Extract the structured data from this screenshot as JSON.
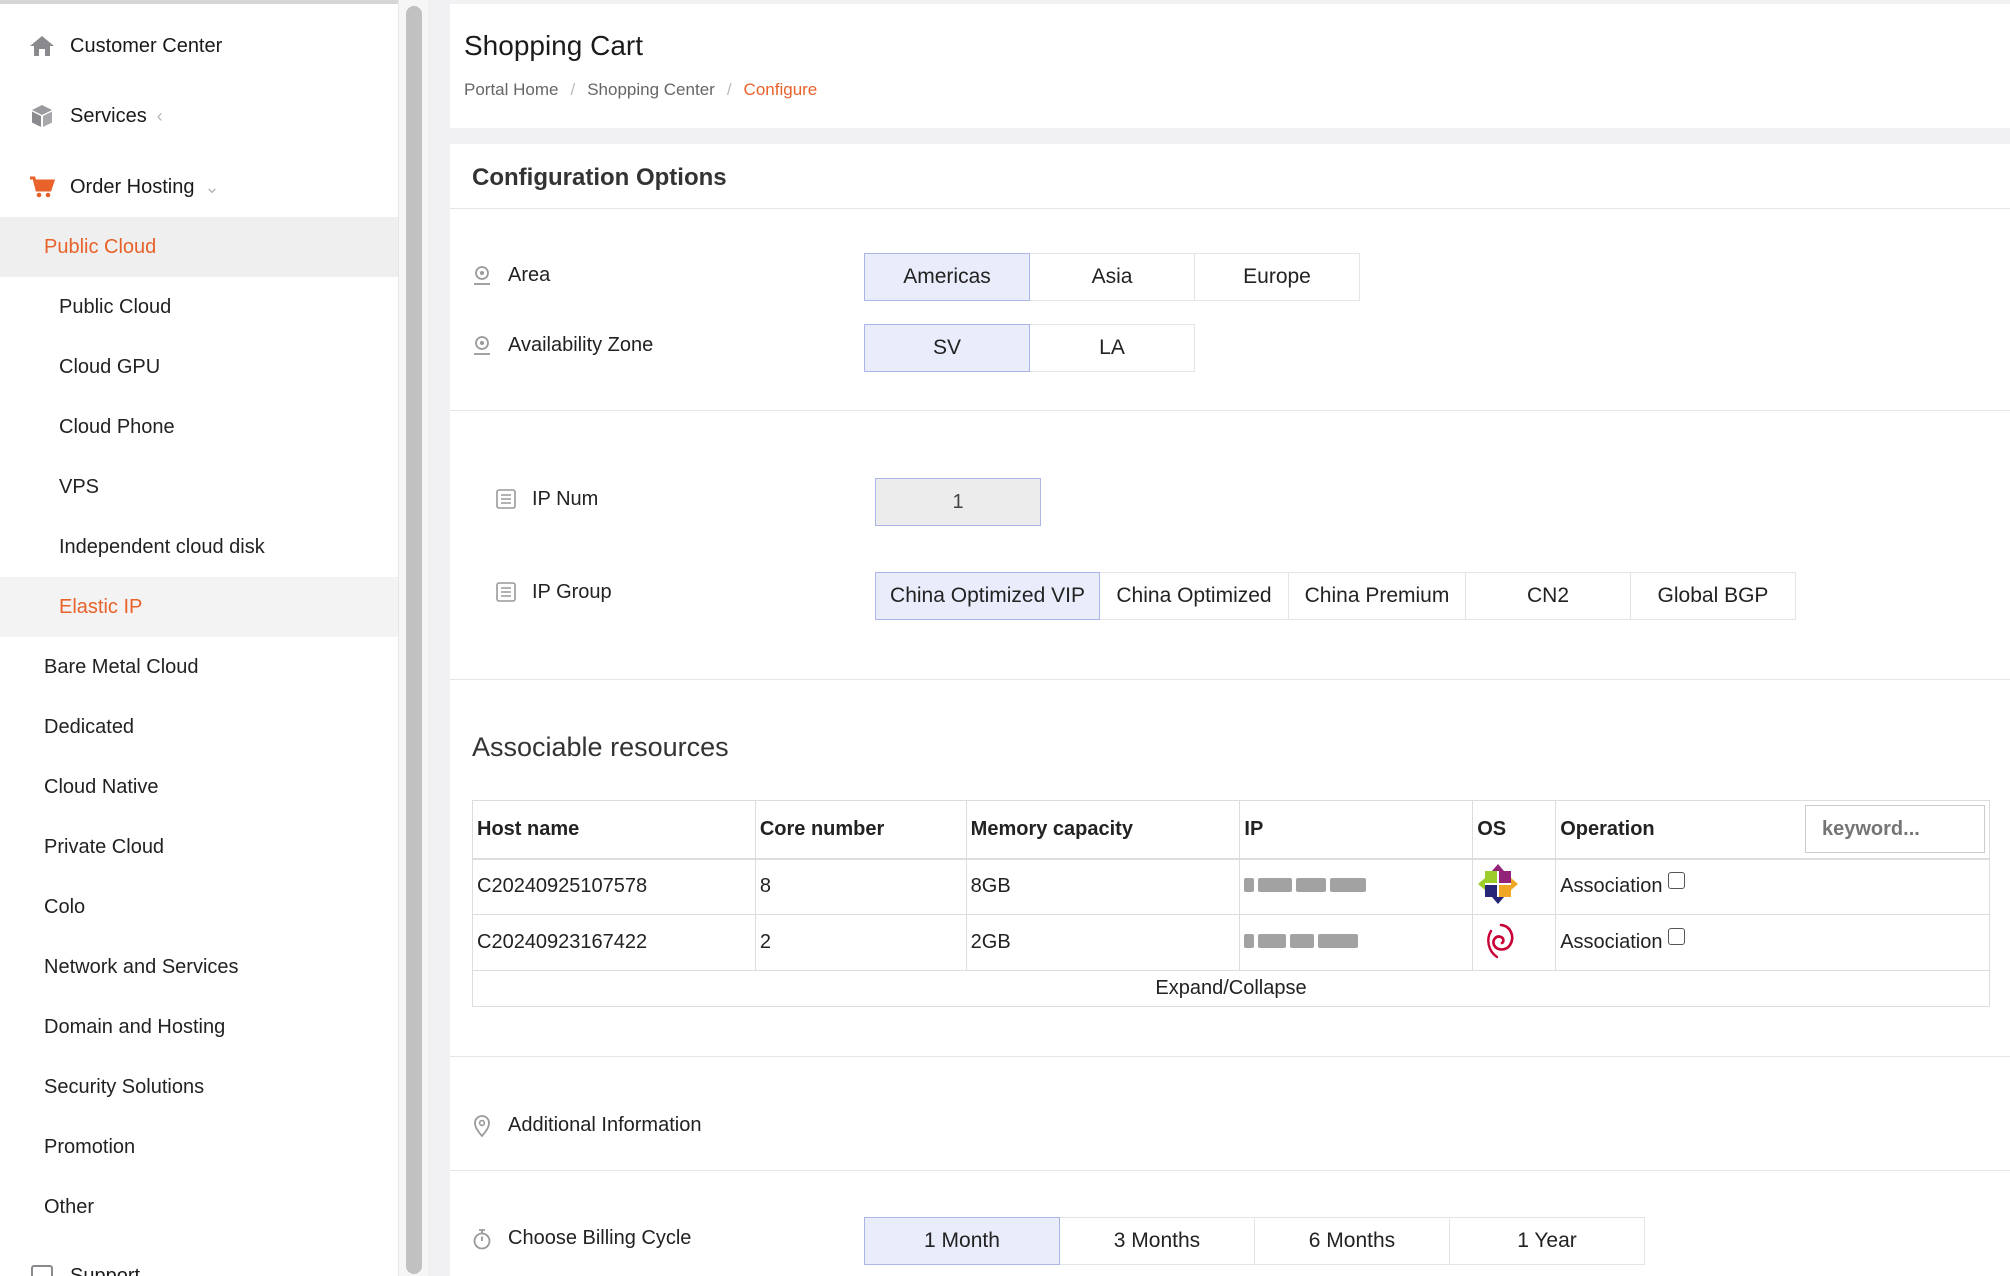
{
  "sidebar": {
    "customer_center": "Customer Center",
    "services": "Services",
    "order_hosting": "Order Hosting",
    "support": "Support",
    "items": [
      {
        "label": "Public Cloud"
      },
      {
        "label": "Public Cloud"
      },
      {
        "label": "Cloud GPU"
      },
      {
        "label": "Cloud Phone"
      },
      {
        "label": "VPS"
      },
      {
        "label": "Independent cloud disk"
      },
      {
        "label": "Elastic IP"
      },
      {
        "label": "Bare Metal Cloud"
      },
      {
        "label": "Dedicated"
      },
      {
        "label": "Cloud Native"
      },
      {
        "label": "Private Cloud"
      },
      {
        "label": "Colo"
      },
      {
        "label": "Network and Services"
      },
      {
        "label": "Domain and Hosting"
      },
      {
        "label": "Security Solutions"
      },
      {
        "label": "Promotion"
      },
      {
        "label": "Other"
      }
    ]
  },
  "header": {
    "title": "Shopping Cart",
    "breadcrumb": [
      "Portal Home",
      "Shopping Center",
      "Configure"
    ]
  },
  "config": {
    "title": "Configuration Options",
    "area": {
      "label": "Area",
      "options": [
        "Americas",
        "Asia",
        "Europe"
      ],
      "selected": "Americas"
    },
    "zone": {
      "label": "Availability Zone",
      "options": [
        "SV",
        "LA"
      ],
      "selected": "SV"
    },
    "ip_num": {
      "label": "IP Num",
      "value": "1"
    },
    "ip_group": {
      "label": "IP Group",
      "options": [
        "China Optimized VIP",
        "China Optimized",
        "China Premium",
        "CN2",
        "Global BGP"
      ],
      "selected": "China Optimized VIP"
    }
  },
  "resources": {
    "title": "Associable resources",
    "columns": [
      "Host name",
      "Core number",
      "Memory capacity",
      "IP",
      "OS",
      "Operation"
    ],
    "keyword_placeholder": "keyword...",
    "rows": [
      {
        "host": "C20240925107578",
        "cores": "8",
        "memory": "8GB",
        "os_icon": "centos-icon",
        "operation": "Association"
      },
      {
        "host": "C20240923167422",
        "cores": "2",
        "memory": "2GB",
        "os_icon": "debian-icon",
        "operation": "Association"
      }
    ],
    "expand_label": "Expand/Collapse"
  },
  "additional": {
    "label": "Additional Information"
  },
  "billing": {
    "label": "Choose Billing Cycle",
    "options": [
      "1 Month",
      "3 Months",
      "6 Months",
      "1 Year"
    ],
    "selected": "1 Month"
  },
  "colors": {
    "accent": "#e8622a",
    "selected_bg": "#e9edfb",
    "selected_border": "#aab6e8"
  }
}
